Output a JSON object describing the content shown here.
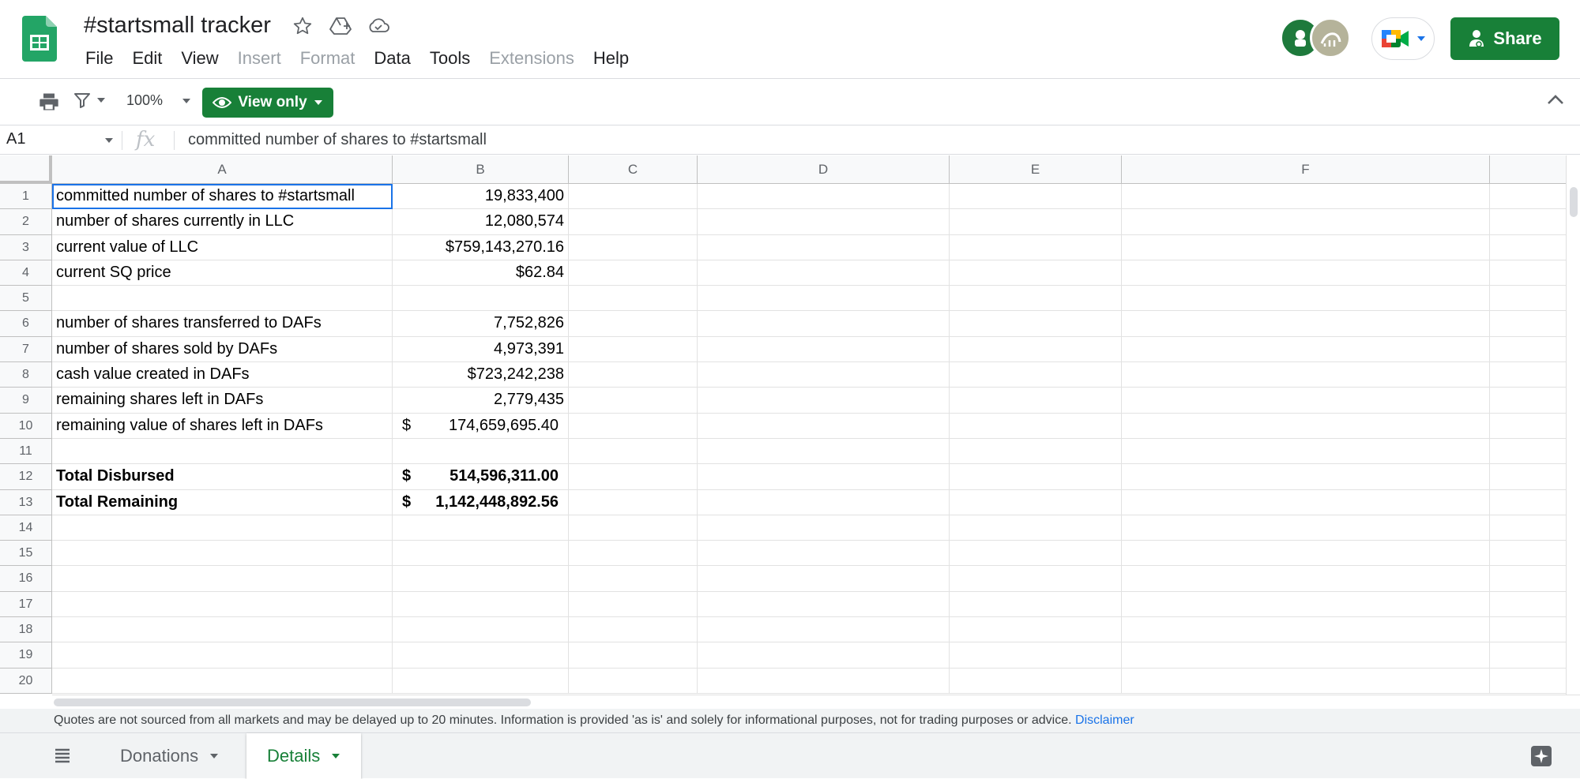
{
  "title": "#startsmall tracker",
  "menu": [
    "File",
    "Edit",
    "View",
    "Insert",
    "Format",
    "Data",
    "Tools",
    "Extensions",
    "Help"
  ],
  "menu_disabled": [
    "Insert",
    "Format",
    "Extensions"
  ],
  "share_label": "Share",
  "toolbar": {
    "zoom": "100%",
    "view_only": "View only"
  },
  "formula_bar": {
    "cell_ref": "A1",
    "fx": "fx",
    "content": "committed number of shares to #startsmall"
  },
  "columns": [
    "A",
    "B",
    "C",
    "D",
    "E",
    "F"
  ],
  "rows": [
    {
      "n": "1",
      "a": "committed number of shares to #startsmall",
      "b": "19,833,400"
    },
    {
      "n": "2",
      "a": "number of shares currently in LLC",
      "b": "12,080,574"
    },
    {
      "n": "3",
      "a": "current value of LLC",
      "b": "$759,143,270.16"
    },
    {
      "n": "4",
      "a": "current SQ price",
      "b": "$62.84"
    },
    {
      "n": "5",
      "a": "",
      "b": ""
    },
    {
      "n": "6",
      "a": "number of shares transferred to DAFs",
      "b": "7,752,826"
    },
    {
      "n": "7",
      "a": "number of shares sold by DAFs",
      "b": "4,973,391"
    },
    {
      "n": "8",
      "a": "cash value created in DAFs",
      "b": "$723,242,238"
    },
    {
      "n": "9",
      "a": "remaining shares left in DAFs",
      "b": "2,779,435"
    },
    {
      "n": "10",
      "a": "remaining value of shares left in DAFs",
      "b_cur": "$",
      "b": "174,659,695.40"
    },
    {
      "n": "11",
      "a": "",
      "b": ""
    },
    {
      "n": "12",
      "a": "Total Disbursed",
      "b_cur": "$",
      "b": "514,596,311.00",
      "bold": true
    },
    {
      "n": "13",
      "a": "Total Remaining",
      "b_cur": "$",
      "b": "1,142,448,892.56",
      "bold": true
    },
    {
      "n": "14",
      "a": "",
      "b": ""
    },
    {
      "n": "15",
      "a": "",
      "b": ""
    },
    {
      "n": "16",
      "a": "",
      "b": ""
    },
    {
      "n": "17",
      "a": "",
      "b": ""
    },
    {
      "n": "18",
      "a": "",
      "b": ""
    },
    {
      "n": "19",
      "a": "",
      "b": ""
    },
    {
      "n": "20",
      "a": "",
      "b": ""
    }
  ],
  "disclaimer": {
    "text": "Quotes are not sourced from all markets and may be delayed up to 20 minutes. Information is provided 'as is' and solely for informational purposes, not for trading purposes or advice. ",
    "link": "Disclaimer"
  },
  "sheets": [
    {
      "name": "Donations",
      "active": false
    },
    {
      "name": "Details",
      "active": true
    }
  ],
  "colors": {
    "brand_green": "#188038",
    "selection_blue": "#1a73e8",
    "link_blue": "#1a73e8"
  },
  "icons": [
    "sheets-logo-icon",
    "star-icon",
    "move-to-drive-icon",
    "cloud-saved-icon",
    "print-icon",
    "filter-icon",
    "eye-icon",
    "chevron-up-icon",
    "meet-icon",
    "person-add-icon",
    "all-sheets-icon",
    "explore-icon"
  ]
}
